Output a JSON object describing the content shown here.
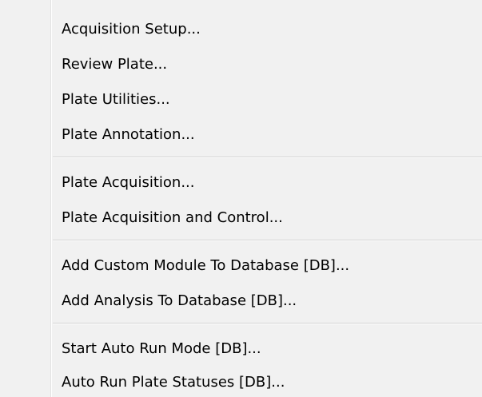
{
  "menu": {
    "items": [
      {
        "label": "Acquisition Setup..."
      },
      {
        "label": "Review Plate..."
      },
      {
        "label": "Plate Utilities..."
      },
      {
        "label": "Plate Annotation..."
      },
      {
        "label": "Plate Acquisition..."
      },
      {
        "label": "Plate Acquisition and Control..."
      },
      {
        "label": "Add Custom Module To Database [DB]..."
      },
      {
        "label": "Add Analysis To Database [DB]..."
      },
      {
        "label": "Start Auto Run Mode [DB]..."
      },
      {
        "label": "Auto Run Plate Statuses [DB]..."
      }
    ]
  }
}
